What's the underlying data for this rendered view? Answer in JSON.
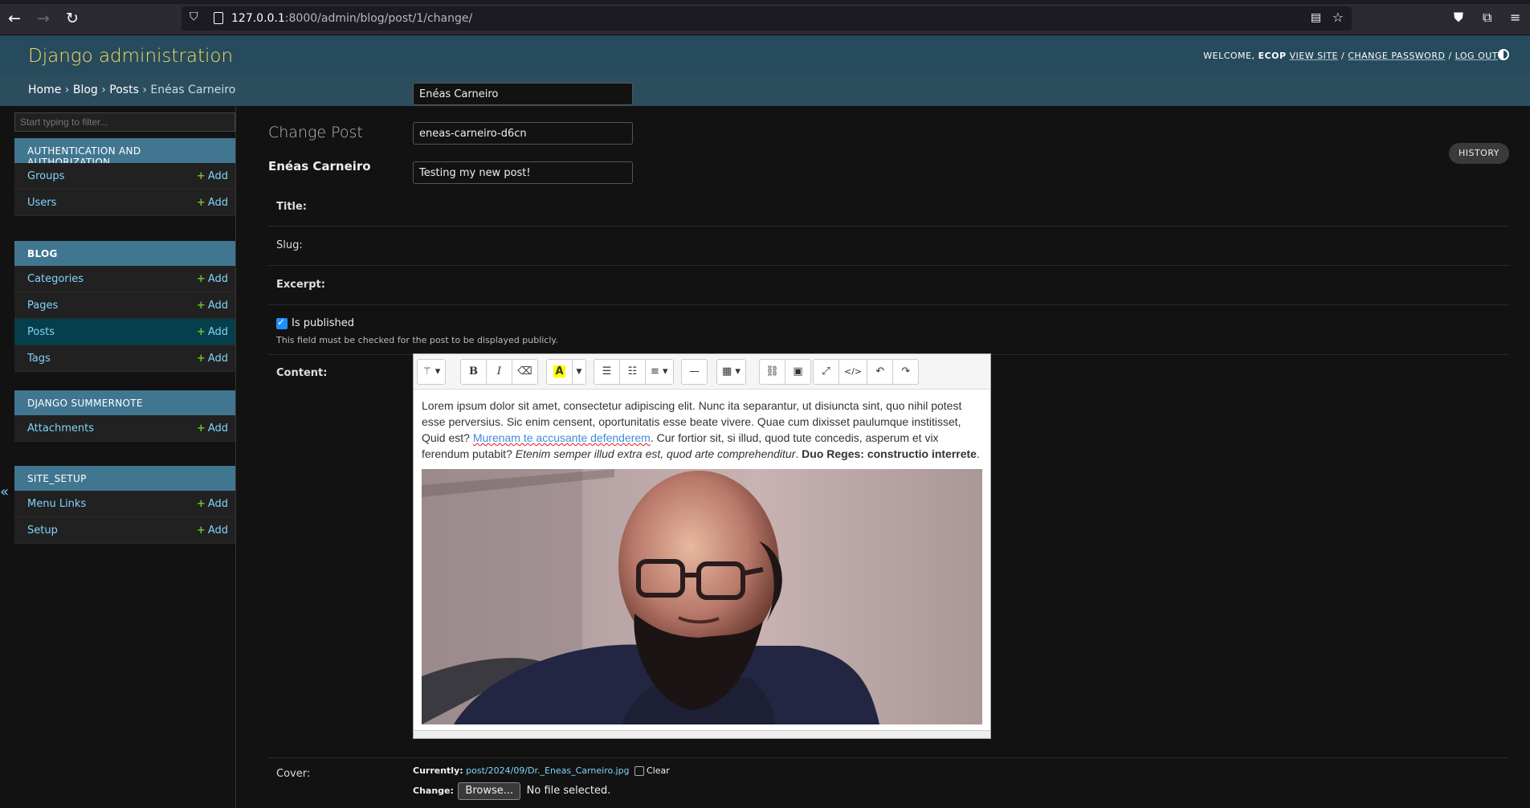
{
  "browser": {
    "url_host": "127.0.0.1",
    "url_rest": ":8000/admin/blog/post/1/change/"
  },
  "header": {
    "branding": "Django administration",
    "welcome": "WELCOME,",
    "username": "ECOP",
    "view_site": "VIEW SITE",
    "change_password": "CHANGE PASSWORD",
    "log_out": "LOG OUT",
    "sep": " / "
  },
  "breadcrumbs": {
    "home": "Home",
    "app": "Blog",
    "model": "Posts",
    "object": "Enéas Carneiro",
    "sep": " › "
  },
  "sidebar": {
    "filter_placeholder": "Start typing to filter...",
    "add_label": "Add",
    "modules": [
      {
        "caption": "AUTHENTICATION AND AUTHORIZATION",
        "items": [
          "Groups",
          "Users"
        ]
      },
      {
        "caption": "BLOG",
        "items": [
          "Categories",
          "Pages",
          "Posts",
          "Tags"
        ]
      },
      {
        "caption": "DJANGO SUMMERNOTE",
        "items": [
          "Attachments"
        ]
      },
      {
        "caption": "SITE_SETUP",
        "items": [
          "Menu Links",
          "Setup"
        ]
      }
    ],
    "collapse_glyph": "«"
  },
  "main": {
    "heading": "Change Post",
    "history": "HISTORY",
    "object_title": "Enéas Carneiro",
    "title_label": "Title:",
    "title_value": "Enéas Carneiro",
    "slug_label": "Slug:",
    "slug_value": "eneas-carneiro-d6cn",
    "excerpt_label": "Excerpt:",
    "excerpt_value": "Testing my new post!",
    "published_label": "Is published",
    "published_checked": true,
    "published_help": "This field must be checked for the post to be displayed publicly.",
    "content_label": "Content:",
    "cover_label": "Cover:",
    "currently_label": "Currently:",
    "cover_file": "post/2024/09/Dr._Eneas_Carneiro.jpg",
    "clear_label": "Clear",
    "change_label": "Change:",
    "browse_label": "Browse...",
    "no_file": "No file selected."
  },
  "editor": {
    "toolbar_icons": [
      "magic-icon",
      "bold-icon",
      "italic-icon",
      "eraser-icon",
      "font-color-icon",
      "ul-icon",
      "ol-icon",
      "align-icon",
      "hr-icon",
      "table-icon",
      "link-icon",
      "picture-icon",
      "fullscreen-icon",
      "code-icon",
      "undo-icon",
      "redo-icon"
    ],
    "content": {
      "p1": "Lorem ipsum dolor sit amet, consectetur adipiscing elit. Nunc ita separantur, ut disiuncta sint, quo nihil potest esse perversius. Sic enim censent, oportunitatis esse beate vivere. Quae cum dixisset paulumque institisset, Quid est? ",
      "link": "Murenam te accusante defenderem",
      "p2": ". Cur fortior sit, si illud, quod tute concedis, asperum et vix ferendum putabit? ",
      "italic": "Etenim semper illud extra est, quod arte comprehenditur",
      "p3": ". ",
      "bold": "Duo Reges: constructio interrete",
      "p4": "."
    }
  }
}
